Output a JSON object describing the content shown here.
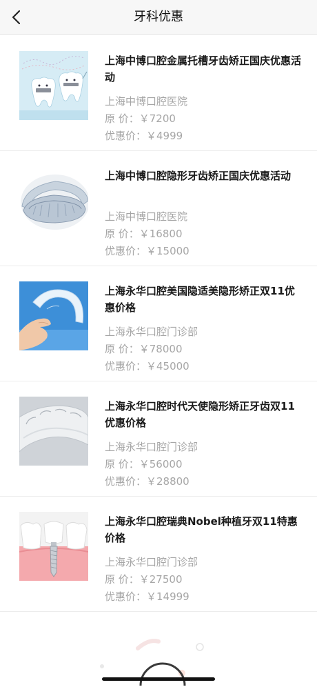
{
  "header": {
    "title": "牙科优惠"
  },
  "items": [
    {
      "name": "上海中博口腔金属托槽牙齿矫正国庆优惠活动",
      "clinic": "上海中博口腔医院",
      "original_price": "原    价：￥7200",
      "promo_price": "优惠价：￥4999",
      "image": "braces-teeth-cartoon"
    },
    {
      "name": "上海中博口腔隐形牙齿矫正国庆优惠活动",
      "clinic": "上海中博口腔医院",
      "original_price": "原    价：￥16800",
      "promo_price": "优惠价：￥15000",
      "image": "clear-aligner"
    },
    {
      "name": "上海永华口腔美国隐适美隐形矫正双11优惠价格",
      "clinic": "上海永华口腔门诊部",
      "original_price": "原    价：￥78000",
      "promo_price": "优惠价：￥45000",
      "image": "aligner-in-hand"
    },
    {
      "name": "上海永华口腔时代天使隐形矫正牙齿双11优惠价格",
      "clinic": "上海永华口腔门诊部",
      "original_price": "原    价：￥56000",
      "promo_price": "优惠价：￥28800",
      "image": "aligner-closeup"
    },
    {
      "name": "上海永华口腔瑞典Nobel种植牙双11特惠价格",
      "clinic": "上海永华口腔门诊部",
      "original_price": "原    价：￥27500",
      "promo_price": "优惠价：￥14999",
      "image": "dental-implant"
    }
  ]
}
